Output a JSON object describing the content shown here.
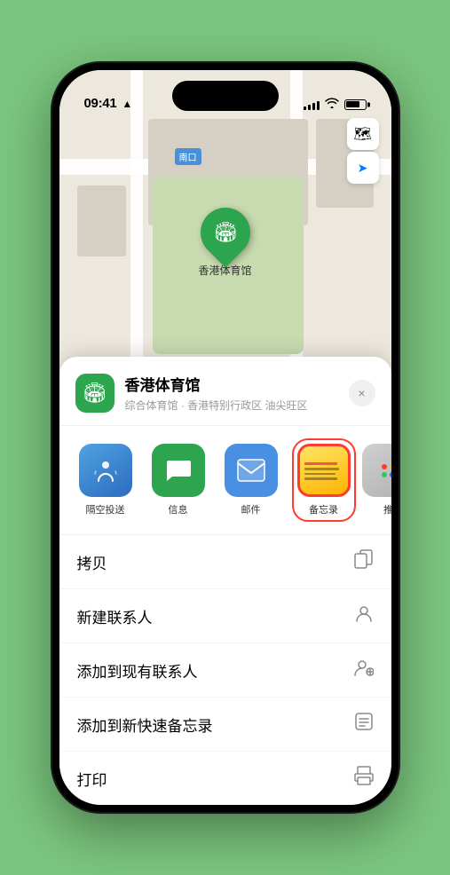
{
  "status_bar": {
    "time": "09:41",
    "location_arrow": "▶"
  },
  "map": {
    "label": "南口",
    "pin_label": "香港体育馆",
    "pin_emoji": "🏟"
  },
  "map_controls": {
    "layers_icon": "🗺",
    "location_icon": "➤"
  },
  "venue_header": {
    "name": "香港体育馆",
    "subtitle": "综合体育馆 · 香港特别行政区 油尖旺区",
    "close_label": "×",
    "icon_emoji": "🏟"
  },
  "share_items": [
    {
      "id": "airdrop",
      "label": "隔空投送",
      "type": "airdrop"
    },
    {
      "id": "messages",
      "label": "信息",
      "type": "messages"
    },
    {
      "id": "mail",
      "label": "邮件",
      "type": "mail"
    },
    {
      "id": "notes",
      "label": "备忘录",
      "type": "notes"
    },
    {
      "id": "more",
      "label": "推",
      "type": "more"
    }
  ],
  "actions": [
    {
      "id": "copy",
      "label": "拷贝",
      "icon": "📋"
    },
    {
      "id": "new-contact",
      "label": "新建联系人",
      "icon": "👤"
    },
    {
      "id": "add-existing",
      "label": "添加到现有联系人",
      "icon": "👤"
    },
    {
      "id": "add-note",
      "label": "添加到新快速备忘录",
      "icon": "🗒"
    },
    {
      "id": "print",
      "label": "打印",
      "icon": "🖨"
    }
  ]
}
